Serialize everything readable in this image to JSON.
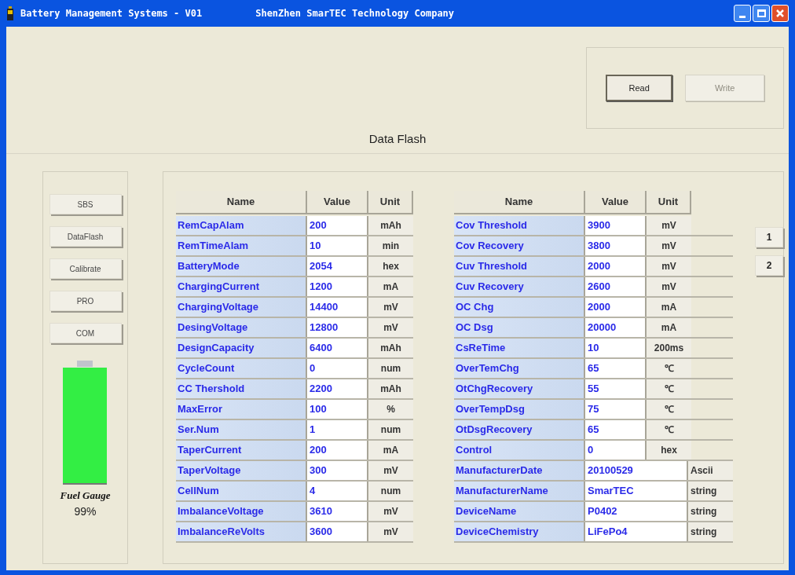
{
  "window": {
    "title": "Battery Management Systems - V01",
    "subtitle": "ShenZhen SmarTEC Technology Company"
  },
  "actions": [
    {
      "label": "Read",
      "disabled": false
    },
    {
      "label": "Write",
      "disabled": true
    }
  ],
  "section_title": "Data Flash",
  "nav": [
    "SBS",
    "DataFlash",
    "Calibrate",
    "PRO",
    "COM"
  ],
  "fuel_gauge": {
    "level": 0.99,
    "label": "Fuel Gauge",
    "reading": "99%"
  },
  "tables": [
    {
      "columns": [
        "Name",
        "Value",
        "Unit"
      ],
      "rows": [
        {
          "kind": "normal",
          "name": "RemCapAlam",
          "value": "200",
          "unit": "mAh"
        },
        {
          "kind": "normal",
          "name": "RemTimeAlam",
          "value": "10",
          "unit": "min"
        },
        {
          "kind": "normal",
          "name": "BatteryMode",
          "value": "2054",
          "unit": "hex"
        },
        {
          "kind": "normal",
          "name": "ChargingCurrent",
          "value": "1200",
          "unit": "mA"
        },
        {
          "kind": "normal",
          "name": "ChargingVoltage",
          "value": "14400",
          "unit": "mV"
        },
        {
          "kind": "normal",
          "name": "DesingVoltage",
          "value": "12800",
          "unit": "mV"
        },
        {
          "kind": "normal",
          "name": "DesignCapacity",
          "value": "6400",
          "unit": "mAh"
        },
        {
          "kind": "normal",
          "name": "CycleCount",
          "value": "0",
          "unit": "num"
        },
        {
          "kind": "normal",
          "name": "CC Thershold",
          "value": "2200",
          "unit": "mAh"
        },
        {
          "kind": "normal",
          "name": "MaxError",
          "value": "100",
          "unit": "%"
        },
        {
          "kind": "normal",
          "name": "Ser.Num",
          "value": "1",
          "unit": "num"
        },
        {
          "kind": "normal",
          "name": "TaperCurrent",
          "value": "200",
          "unit": "mA"
        },
        {
          "kind": "normal",
          "name": "TaperVoltage",
          "value": "300",
          "unit": "mV"
        },
        {
          "kind": "normal",
          "name": "CellNum",
          "value": "4",
          "unit": "num"
        },
        {
          "kind": "normal",
          "name": "ImbalanceVoltage",
          "value": "3610",
          "unit": "mV"
        },
        {
          "kind": "normal",
          "name": "ImbalanceReVolts",
          "value": "3600",
          "unit": "mV"
        }
      ]
    },
    {
      "columns": [
        "Name",
        "Value",
        "Unit"
      ],
      "rows": [
        {
          "kind": "normal",
          "name": "Cov Threshold",
          "value": "3900",
          "unit": "mV"
        },
        {
          "kind": "normal",
          "name": "Cov Recovery",
          "value": "3800",
          "unit": "mV"
        },
        {
          "kind": "normal",
          "name": "Cuv Threshold",
          "value": "2000",
          "unit": "mV"
        },
        {
          "kind": "normal",
          "name": "Cuv Recovery",
          "value": "2600",
          "unit": "mV"
        },
        {
          "kind": "normal",
          "name": "OC Chg",
          "value": "2000",
          "unit": "mA"
        },
        {
          "kind": "normal",
          "name": "OC Dsg",
          "value": "20000",
          "unit": "mA"
        },
        {
          "kind": "normal",
          "name": "CsReTime",
          "value": "10",
          "unit": "200ms"
        },
        {
          "kind": "normal",
          "name": "OverTemChg",
          "value": "65",
          "unit": "℃"
        },
        {
          "kind": "normal",
          "name": "OtChgRecovery",
          "value": "55",
          "unit": "℃"
        },
        {
          "kind": "normal",
          "name": "OverTempDsg",
          "value": "75",
          "unit": "℃"
        },
        {
          "kind": "normal",
          "name": "OtDsgRecovery",
          "value": "65",
          "unit": "℃"
        },
        {
          "kind": "normal",
          "name": "Control",
          "value": "0",
          "unit": "hex"
        },
        {
          "kind": "string",
          "name": "ManufacturerDate",
          "value": "20100529",
          "unit": "Ascii"
        },
        {
          "kind": "string",
          "name": "ManufacturerName",
          "value": "SmarTEC",
          "unit": "string"
        },
        {
          "kind": "string",
          "name": "DeviceName",
          "value": "P0402",
          "unit": "string"
        },
        {
          "kind": "string",
          "name": "DeviceChemistry",
          "value": "LiFePo4",
          "unit": "string"
        }
      ]
    }
  ],
  "pages": [
    "1",
    "2"
  ]
}
